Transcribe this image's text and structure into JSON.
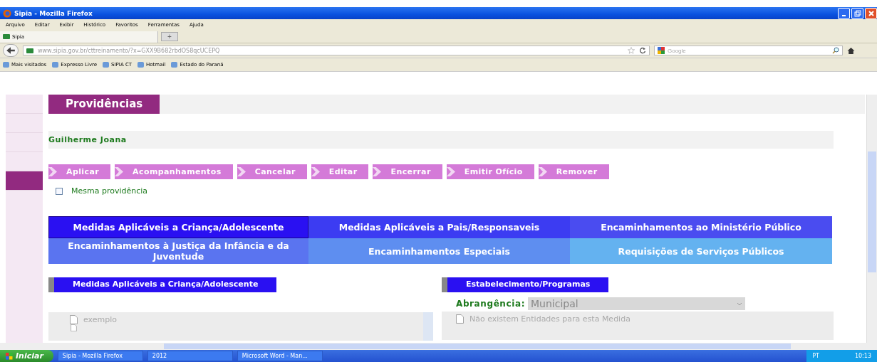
{
  "window": {
    "title": "Sipia - Mozilla Firefox"
  },
  "menu": [
    "Arquivo",
    "Editar",
    "Exibir",
    "Histórico",
    "Favoritos",
    "Ferramentas",
    "Ajuda"
  ],
  "browser_tabs": [
    {
      "label": "Sipia"
    }
  ],
  "new_tab": "+",
  "address": {
    "value": "www.sipia.gov.br/cttreinamento/?x=GXX9B682rbdOS8qcUCEPQ"
  },
  "search": {
    "placeholder": "Google"
  },
  "bookmarks": [
    "Mais visitados",
    "Expresso Livre",
    "SIPIA CT",
    "Hotmail",
    "Estado do Paraná"
  ],
  "sidebar": {
    "items": [
      {
        "selected": false
      },
      {
        "selected": false
      },
      {
        "selected": false
      },
      {
        "selected": false
      },
      {
        "selected": true
      }
    ]
  },
  "page_title": "Providências",
  "person": "Guilherme Joana",
  "actions": [
    "Aplicar",
    "Acompanhamentos",
    "Cancelar",
    "Editar",
    "Encerrar",
    "Emitir Ofício",
    "Remover"
  ],
  "same_option": {
    "label": "Mesma providência",
    "checked": false
  },
  "category_tabs": [
    {
      "label": "Medidas Aplicáveis a Criança/Adolescente",
      "selected": true,
      "color": "#2a10f2"
    },
    {
      "label": "Medidas Aplicáveis a Pais/Responsaveis",
      "selected": false,
      "color": "#3c3cf2"
    },
    {
      "label": "Encaminhamentos ao Ministério Público",
      "selected": false,
      "color": "#4a4cf0"
    },
    {
      "label": "Encaminhamentos à Justiça da Infância e da Juventude",
      "selected": false,
      "color": "#5a74f0"
    },
    {
      "label": "Encaminhamentos Especiais",
      "selected": false,
      "color": "#5e8ef0"
    },
    {
      "label": "Requisições de Serviços Públicos",
      "selected": false,
      "color": "#64b2f0"
    }
  ],
  "left_panel": {
    "heading": "Medidas Aplicáveis a Criança/Adolescente",
    "items": [
      "exemplo"
    ]
  },
  "right_panel": {
    "heading": "Estabelecimento/Programas",
    "scope_label": "Abrangência:",
    "scope_value": "Municipal",
    "items": [
      "Não existem Entidades para esta Medida"
    ]
  },
  "taskbar": {
    "start": "Iniciar",
    "tasks": [
      "Sipia - Mozilla Firefox",
      "2012",
      "Microsoft Word - Man..."
    ],
    "language": "PT",
    "time": "10:13"
  }
}
